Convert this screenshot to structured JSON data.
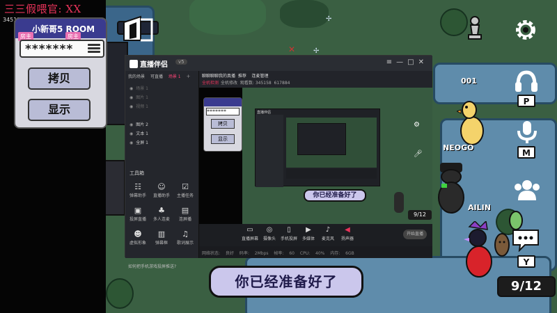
{
  "stream_overlay": {
    "marquee": "三三假喂官: XX",
    "small_tag": "345158"
  },
  "room_panel": {
    "title": "小新哥5 ROOM",
    "tag_left": "房主",
    "tag_right": "房主",
    "password": "*******",
    "copy_button": "拷贝",
    "show_button": "显示"
  },
  "hud": {
    "settings_icon": "gear-icon",
    "headphones_key": "P",
    "mic_key": "M",
    "chat_key": "Y",
    "player_count": "9/12",
    "subtitle": "你已经准备好了"
  },
  "players": {
    "player_001": "001",
    "player_neogo": "NEOGO",
    "player_ailin": "AILIN"
  },
  "streaming_app": {
    "title": "直播伴侣",
    "version": "v5",
    "sidebar_tabs": [
      {
        "label": "我的场景",
        "active": false
      },
      {
        "label": "可直播",
        "active": false
      },
      {
        "label": "场景 1",
        "active": true
      }
    ],
    "scenes": [
      {
        "label": "场景 1",
        "dim": true
      },
      {
        "label": "图片 1",
        "dim": true
      },
      {
        "label": "视频 1",
        "dim": true
      },
      {
        "label": "图片 2",
        "dim": false
      },
      {
        "label": "文本 1",
        "dim": false
      },
      {
        "label": "全屏 1",
        "dim": false
      }
    ],
    "tools_header": "工具箱",
    "tools": [
      {
        "label": "弹幕助手",
        "icon": "chat-icon"
      },
      {
        "label": "直播助手",
        "icon": "user-icon"
      },
      {
        "label": "主播任务",
        "icon": "task-icon"
      },
      {
        "label": "投屏直播",
        "icon": "cast-icon"
      },
      {
        "label": "多人连麦",
        "icon": "people-icon"
      },
      {
        "label": "连屏播",
        "icon": "screen-icon"
      },
      {
        "label": "虚拟形象",
        "icon": "avatar-icon"
      },
      {
        "label": "弹幕框",
        "icon": "box-icon"
      },
      {
        "label": "歌词展示",
        "icon": "lyrics-icon"
      }
    ],
    "bottom_note": "如何把手机游戏投屏推送?",
    "top_title": "聊聊聊聊我的真播",
    "top_chip_1": "推荐",
    "top_chip_2": "连麦管理",
    "top_status_tag": "全机检测",
    "top_status_2": "全机修改",
    "top_count_label": "观看数:",
    "top_count_value": "345158",
    "top_fans": "617884",
    "controls": [
      {
        "label": "直播屏幕",
        "icon": "screen-icon"
      },
      {
        "label": "摄像头",
        "icon": "camera-icon"
      },
      {
        "label": "手机投屏",
        "icon": "phone-icon"
      },
      {
        "label": "多媒体",
        "icon": "media-icon"
      },
      {
        "label": "麦克风",
        "icon": "mic-icon"
      },
      {
        "label": "扬声器",
        "icon": "speaker-icon"
      }
    ],
    "start_button": "开始直播",
    "status_bar": "网络状态: 良好  码率: 2Mbps  帧率: 60  CPU: 40%  内存: 6GB"
  }
}
